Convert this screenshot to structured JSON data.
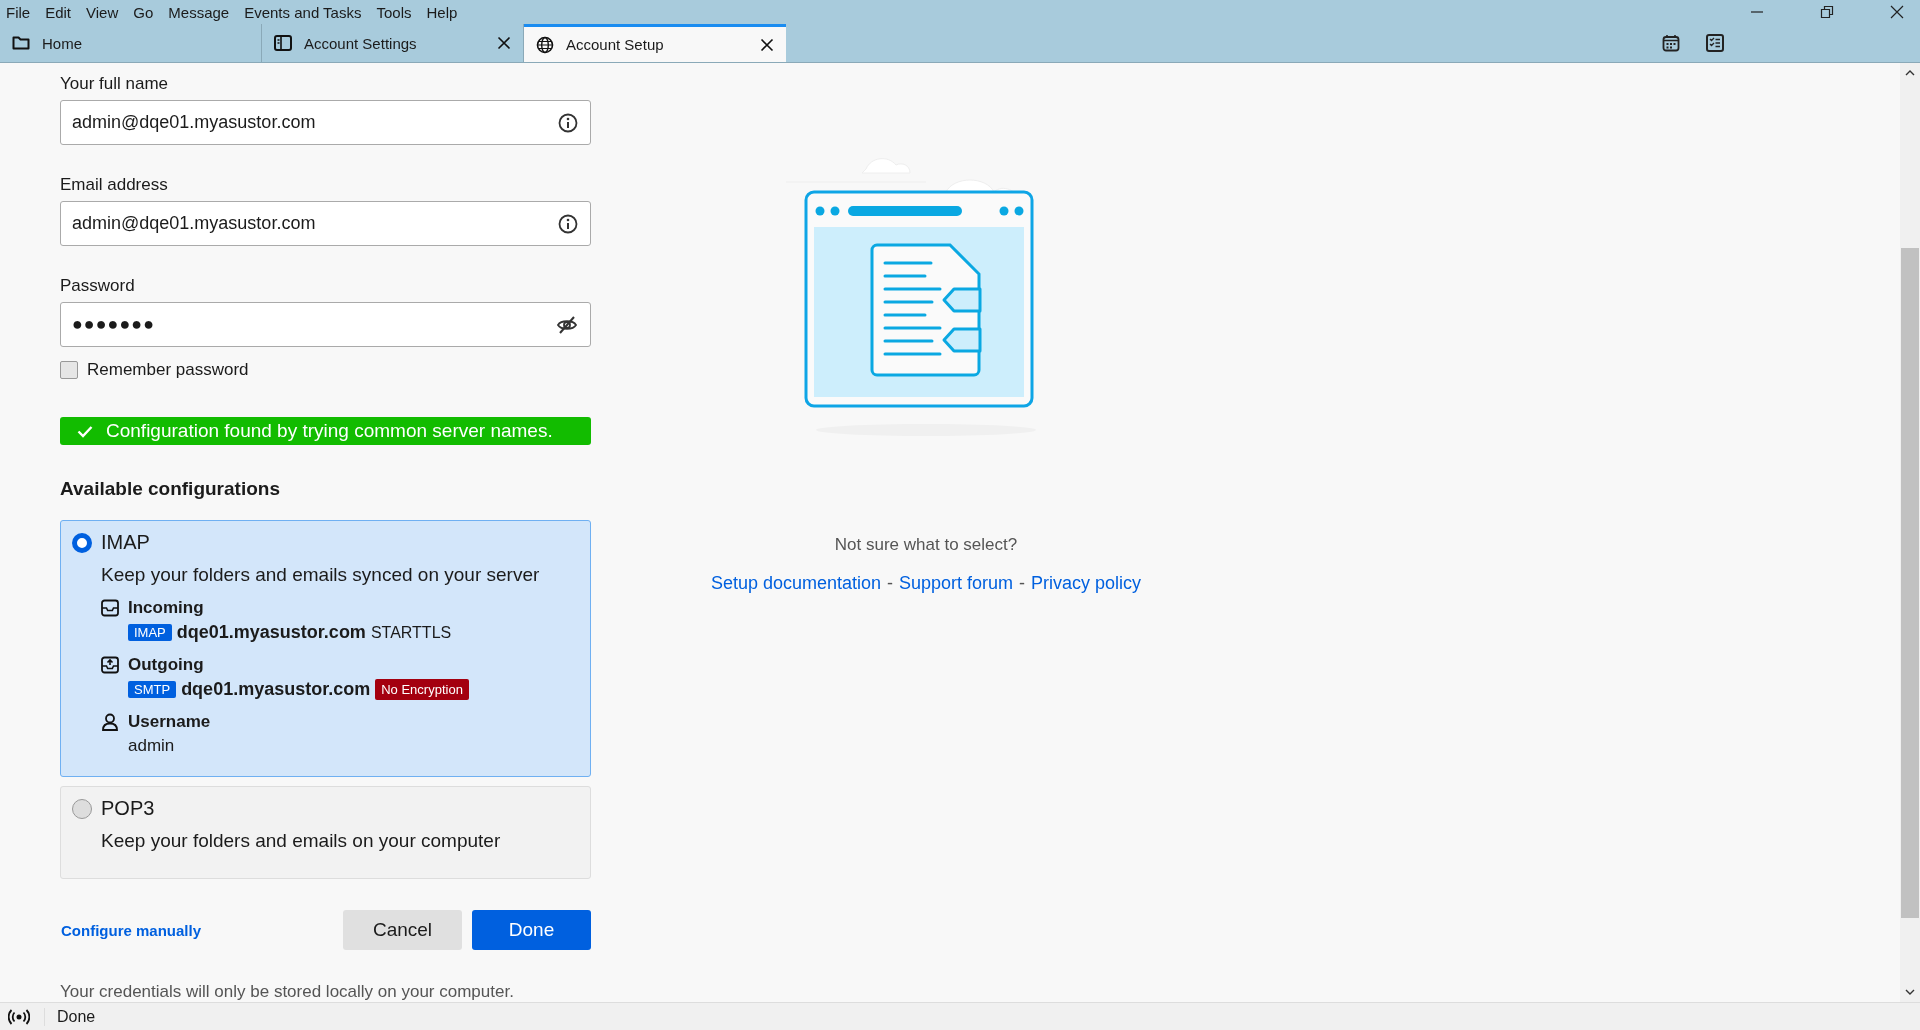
{
  "menu": [
    "File",
    "Edit",
    "View",
    "Go",
    "Message",
    "Events and Tasks",
    "Tools",
    "Help"
  ],
  "tabs": [
    {
      "label": "Home",
      "kind": "folder",
      "closable": false,
      "selected": false
    },
    {
      "label": "Account Settings",
      "kind": "book",
      "closable": true,
      "selected": false
    },
    {
      "label": "Account Setup",
      "kind": "globe",
      "closable": true,
      "selected": true
    }
  ],
  "fields": [
    {
      "label": "Your full name",
      "value": "admin@dqe01.myasustor.com",
      "kind": "info"
    },
    {
      "label": "Email address",
      "value": "admin@dqe01.myasustor.com",
      "kind": "info"
    },
    {
      "label": "Password",
      "value": "●●●●●●●",
      "kind": "password"
    }
  ],
  "remember": {
    "label": "Remember password",
    "checked": false
  },
  "banner": {
    "text": "Configuration found by trying common server names."
  },
  "configs_title": "Available configurations",
  "configs": [
    {
      "name": "IMAP",
      "description": "Keep your folders and emails synced on your server",
      "selected": true,
      "details": [
        {
          "kind": "incoming",
          "label": "Incoming",
          "protocol": "IMAP",
          "host": "dqe01.myasustor.com",
          "security": {
            "text": "STARTTLS",
            "kind": "plain"
          }
        },
        {
          "kind": "outgoing",
          "label": "Outgoing",
          "protocol": "SMTP",
          "host": "dqe01.myasustor.com",
          "security": {
            "text": "No Encryption",
            "kind": "warning"
          }
        },
        {
          "kind": "user",
          "label": "Username",
          "value": "admin"
        }
      ]
    },
    {
      "name": "POP3",
      "description": "Keep your folders and emails on your computer",
      "selected": false
    }
  ],
  "configure_link": "Configure manually",
  "buttons": [
    {
      "label": "Cancel",
      "kind": "secondary"
    },
    {
      "label": "Done",
      "kind": "primary"
    }
  ],
  "note": "Your credentials will only be stored locally on your computer.",
  "help": {
    "question": "Not sure what to select?",
    "separator": "-",
    "links": [
      "Setup documentation",
      "Support forum",
      "Privacy policy"
    ]
  },
  "status": {
    "text": "Done"
  }
}
